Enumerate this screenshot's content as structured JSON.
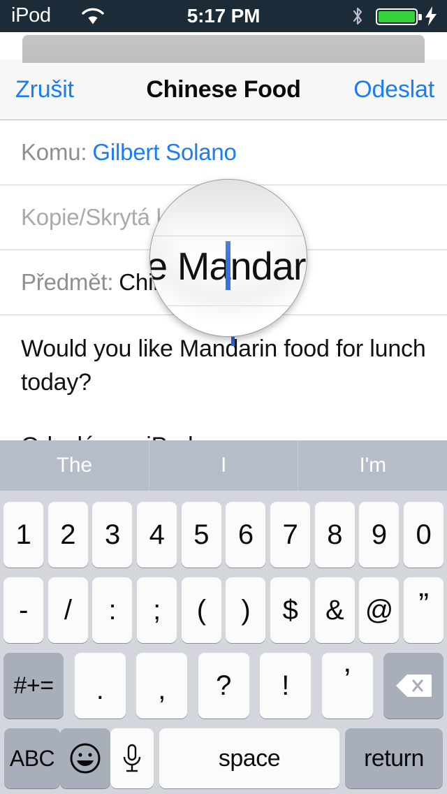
{
  "status_bar": {
    "carrier": "iPod",
    "time": "5:17 PM",
    "wifi_icon": "wifi-icon",
    "bluetooth_icon": "bluetooth-icon",
    "battery_icon": "battery-icon",
    "charging_icon": "lightning-bolt-icon",
    "battery_color": "#37d23c",
    "background_color": "#1b2b38"
  },
  "nav_bar": {
    "cancel_label": "Zrušit",
    "title": "Chinese Food",
    "send_label": "Odeslat",
    "tint_color": "#1c7cf5"
  },
  "compose": {
    "to": {
      "label": "Komu:",
      "value": "Gilbert Solano"
    },
    "cc_bcc": {
      "placeholder": "Kopie/Skrytá kopie:",
      "value": ""
    },
    "subject": {
      "label": "Předmět:",
      "value": "Chinese Food"
    },
    "body": "Would you like Mandarin food for lunch today?",
    "signature": "Odesláno z iPodu"
  },
  "magnifier": {
    "icon": "text-loupe-icon",
    "magnified_text": "e Mandarin fo",
    "caret_color": "#3a6fe0"
  },
  "keyboard": {
    "layout": "numbers-symbols",
    "suggestions": [
      "The",
      "I",
      "I'm"
    ],
    "row1": [
      "1",
      "2",
      "3",
      "4",
      "5",
      "6",
      "7",
      "8",
      "9",
      "0"
    ],
    "row2": [
      "-",
      "/",
      ":",
      ";",
      "(",
      ")",
      "$",
      "&",
      "@",
      "”"
    ],
    "row3_shift_label": "#+=",
    "row3": [
      ".",
      ",",
      "?",
      "!",
      "’"
    ],
    "row3_delete_icon": "backspace-icon",
    "bottom": {
      "abc_label": "ABC",
      "emoji_icon": "smiley-face-icon",
      "mic_icon": "microphone-icon",
      "space_label": "space",
      "return_label": "return"
    },
    "background_color": "#d3d6dc",
    "suggestion_bar_color": "#b6bcc8"
  }
}
